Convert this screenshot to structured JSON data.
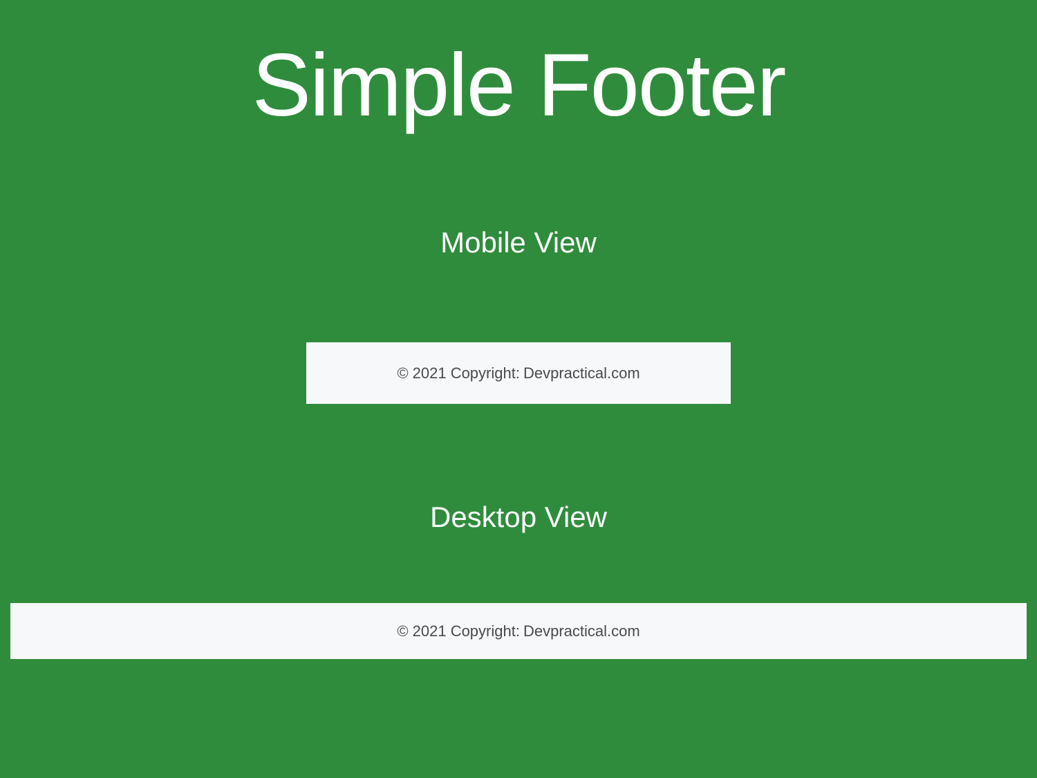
{
  "title": "Simple Footer",
  "sections": {
    "mobile": {
      "heading": "Mobile View",
      "footer_prefix": "© 2021 Copyright:",
      "footer_link": "Devpractical.com"
    },
    "desktop": {
      "heading": "Desktop View",
      "footer_prefix": "© 2021 Copyright:",
      "footer_link": "Devpractical.com"
    }
  }
}
